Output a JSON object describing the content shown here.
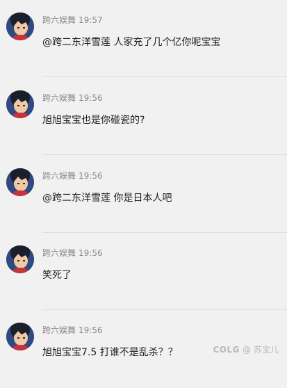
{
  "posts": [
    {
      "username": "跨六娱舞",
      "time": "19:57",
      "text": "@跨二东洋雪莲 人家充了几个亿你呢宝宝"
    },
    {
      "username": "跨六娱舞",
      "time": "19:56",
      "text": "旭旭宝宝也是你碰瓷的?"
    },
    {
      "username": "跨六娱舞",
      "time": "19:56",
      "text": "@跨二东洋雪莲 你是日本人吧"
    },
    {
      "username": "跨六娱舞",
      "time": "19:56",
      "text": "笑死了"
    },
    {
      "username": "跨六娱舞",
      "time": "19:56",
      "text": "旭旭宝宝7.5 打谁不是乱杀？？"
    }
  ],
  "watermark": {
    "brand": "COLG",
    "at": "@",
    "user": "苏宝儿"
  }
}
